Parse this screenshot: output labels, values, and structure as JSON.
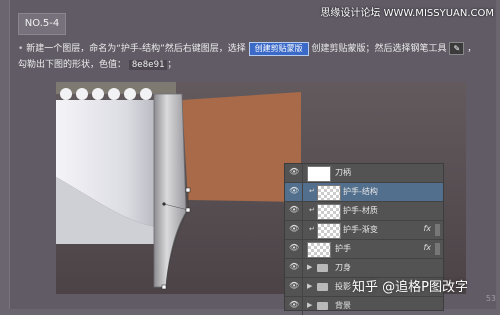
{
  "watermark_top": "思缘设计论坛 WWW.MISSYUAN.COM",
  "step": "NO.5-4",
  "instruction": {
    "bullet": "•",
    "text1": "新建一个图层，命名为“护手-结构”然后右键图层，选择",
    "chip": "创建剪贴蒙版",
    "text2": "创建剪贴蒙版；然后选择钢笔工具",
    "pen_icon": "pen-icon",
    "text3": "，勾勒出下图的形状，色值：",
    "color_value": "8e8e91",
    "text4": "；"
  },
  "layers": [
    {
      "name": "刀柄",
      "type": "layer",
      "selected": false,
      "clipped": false,
      "fx": false
    },
    {
      "name": "护手-结构",
      "type": "layer",
      "selected": true,
      "clipped": true,
      "fx": false
    },
    {
      "name": "护手-材质",
      "type": "layer",
      "selected": false,
      "clipped": true,
      "fx": false
    },
    {
      "name": "护手-渐变",
      "type": "layer",
      "selected": false,
      "clipped": true,
      "fx": true
    },
    {
      "name": "护手",
      "type": "layer",
      "selected": false,
      "clipped": false,
      "fx": true
    },
    {
      "name": "刀身",
      "type": "group",
      "selected": false,
      "clipped": false,
      "fx": false
    },
    {
      "name": "投影",
      "type": "group",
      "selected": false,
      "clipped": false,
      "fx": false
    },
    {
      "name": "背景",
      "type": "group",
      "selected": false,
      "clipped": false,
      "fx": false
    }
  ],
  "fx_label": "fx",
  "eye_glyph": "👁",
  "clip_glyph": "↵",
  "arrow_glyph": "▶",
  "watermark_bottom": "知乎 @追格P图改字",
  "page_number": "53",
  "colors": {
    "background": "#615b66",
    "selected_layer": "#526f8d",
    "chip": "#3a69c7",
    "handle": "#a86a49",
    "guard": "#b8b8bc",
    "blade": "#e9e9ee",
    "fill_color": "#8e8e91"
  }
}
